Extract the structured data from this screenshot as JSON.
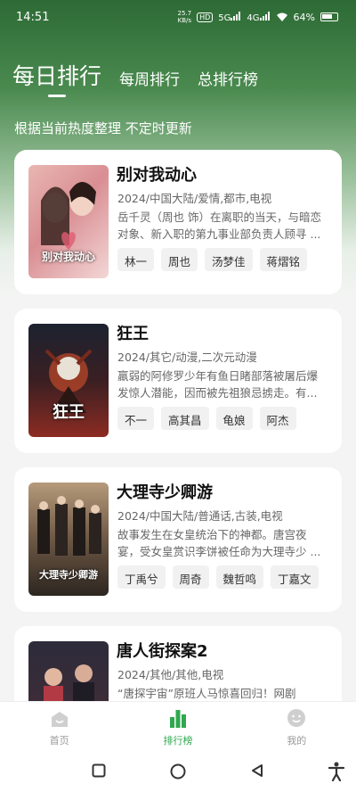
{
  "status": {
    "time": "14:51",
    "speed": "25.7\nKB/s",
    "hd": "HD",
    "net1": "5G",
    "net2": "4G",
    "battery": "64%"
  },
  "tabs": [
    {
      "label": "每日排行"
    },
    {
      "label": "每周排行"
    },
    {
      "label": "总排行榜"
    }
  ],
  "subtitle": "根据当前热度整理 不定时更新",
  "cards": [
    {
      "title": "别对我动心",
      "meta": "2024/中国大陆/爱情,都市,电视",
      "desc": "岳千灵（周也 饰）在离职的当天，与暗恋对象、新入职的第九事业部负责人顾寻 ...",
      "tags": [
        "林一",
        "周也",
        "汤梦佳",
        "蒋熠铭"
      ],
      "poster_text": "别对我动心"
    },
    {
      "title": "狂王",
      "meta": "2024/其它/动漫,二次元动漫",
      "desc": "羸弱的阿修罗少年有鱼日睹部落被屠后爆发惊人潜能，因而被先祖狼忌掳走。有...",
      "tags": [
        "不一",
        "高其昌",
        "龟娘",
        "阿杰"
      ],
      "poster_text": "狂王"
    },
    {
      "title": "大理寺少卿游",
      "meta": "2024/中国大陆/普通话,古装,电视",
      "desc": "故事发生在女皇统治下的神都。唐宫夜宴，受女皇赏识李饼被任命为大理寺少 ...",
      "tags": [
        "丁禹兮",
        "周奇",
        "魏哲鸣",
        "丁嘉文"
      ],
      "poster_text": "大理寺少卿游"
    },
    {
      "title": "唐人街探案2",
      "meta": "2024/其他/其他,电视",
      "desc": "“唐探宇宙”原班人马惊喜回归！网剧",
      "tags": [],
      "poster_text": ""
    }
  ],
  "tabbar": [
    {
      "label": "首页"
    },
    {
      "label": "排行榜"
    },
    {
      "label": "我的"
    }
  ],
  "colors": {
    "accent": "#2fa84f",
    "header": "#2d6a35"
  }
}
